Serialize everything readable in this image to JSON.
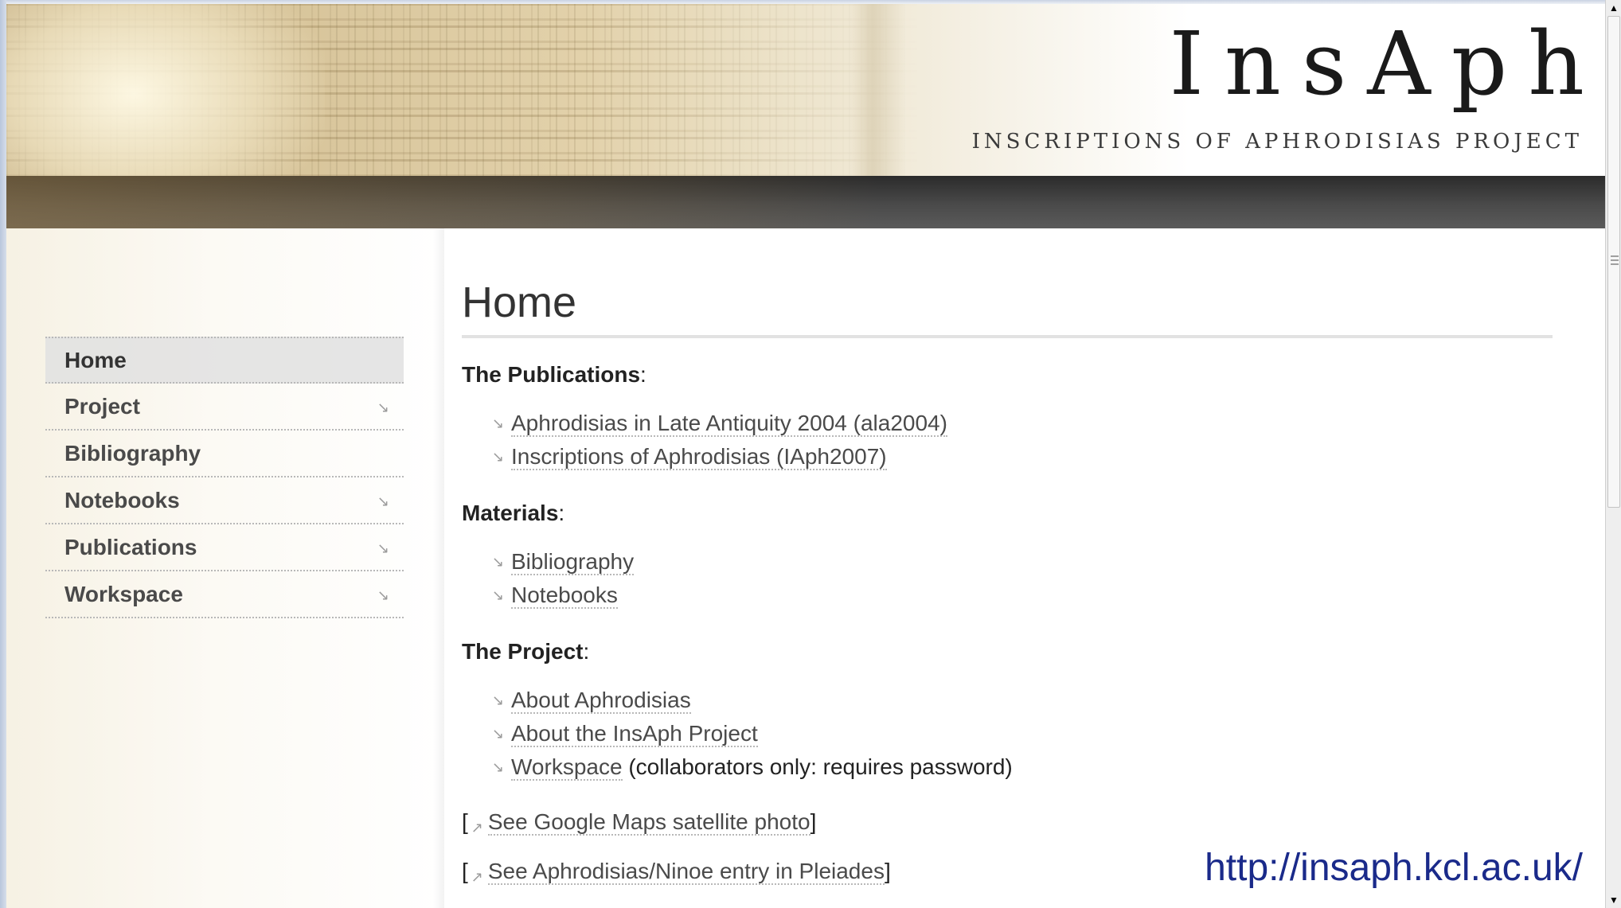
{
  "banner": {
    "title": "InsAph",
    "subtitle": "INSCRIPTIONS OF APHRODISIAS PROJECT"
  },
  "nav": {
    "items": [
      {
        "label": "Home",
        "active": true,
        "has_submenu": false
      },
      {
        "label": "Project",
        "active": false,
        "has_submenu": true
      },
      {
        "label": "Bibliography",
        "active": false,
        "has_submenu": false
      },
      {
        "label": "Notebooks",
        "active": false,
        "has_submenu": true
      },
      {
        "label": "Publications",
        "active": false,
        "has_submenu": true
      },
      {
        "label": "Workspace",
        "active": false,
        "has_submenu": true
      }
    ],
    "submenu_icon": "corner-arrow-icon"
  },
  "main": {
    "title": "Home",
    "sections": [
      {
        "heading": "The Publications",
        "links": [
          {
            "label": "Aphrodisias in Late Antiquity 2004 (ala2004)",
            "suffix": ""
          },
          {
            "label": "Inscriptions of Aphrodisias (IAph2007)",
            "suffix": ""
          }
        ]
      },
      {
        "heading": "Materials",
        "links": [
          {
            "label": "Bibliography",
            "suffix": ""
          },
          {
            "label": "Notebooks",
            "suffix": ""
          }
        ]
      },
      {
        "heading": "The Project",
        "links": [
          {
            "label": "About Aphrodisias",
            "suffix": ""
          },
          {
            "label": "About the InsAph Project",
            "suffix": ""
          },
          {
            "label": "Workspace",
            "suffix": " (collaborators only: requires password)"
          }
        ]
      }
    ],
    "external_links": [
      {
        "label": "See Google Maps satellite photo"
      },
      {
        "label": "See Aphrodisias/Ninoe entry in Pleiades"
      }
    ]
  },
  "overlay_url": "http://insaph.kcl.ac.uk/",
  "colors": {
    "link_text": "#4a4a4a",
    "overlay_url": "#1a2a8a",
    "banner_band": "#3a3a3a"
  }
}
